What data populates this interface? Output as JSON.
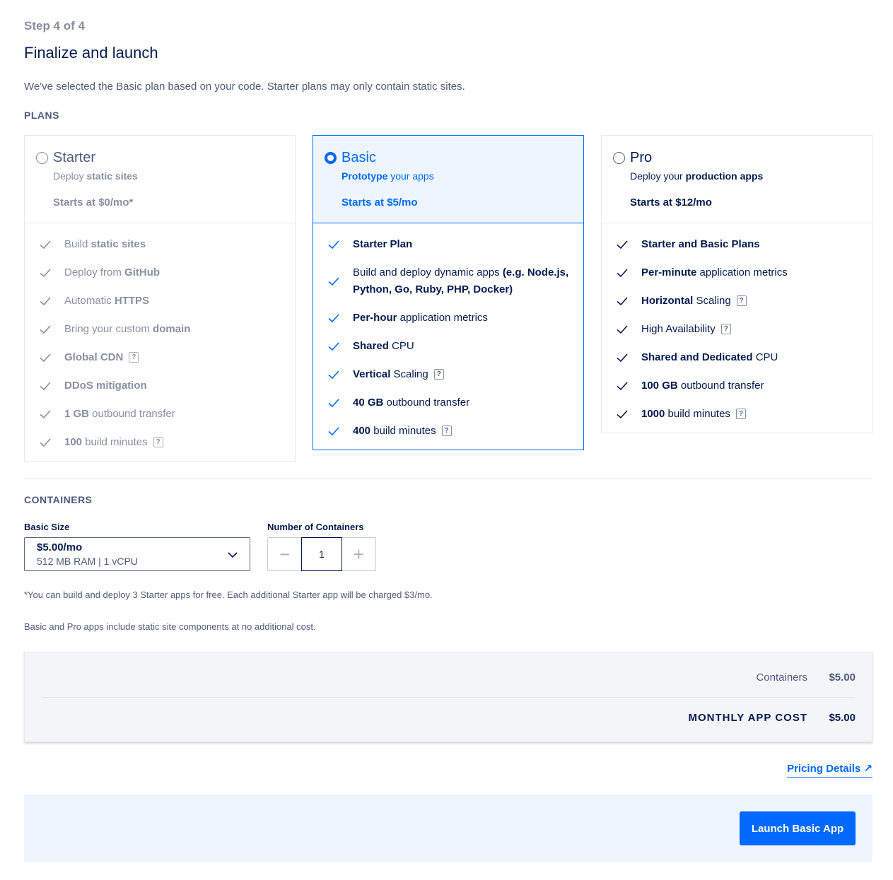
{
  "header": {
    "step": "Step 4 of 4",
    "title": "Finalize and launch",
    "subtitle": "We've selected the Basic plan based on your code. Starter plans may only contain static sites."
  },
  "plans_label": "PLANS",
  "plans": {
    "starter": {
      "name": "Starter",
      "desc_html": "Deploy <b>static sites</b>",
      "price": "Starts at $0/mo*",
      "selected": false,
      "features": [
        {
          "html": "Build <b>static sites</b>",
          "help": false
        },
        {
          "html": "Deploy from <b>GitHub</b>",
          "help": false
        },
        {
          "html": "Automatic <b>HTTPS</b>",
          "help": false
        },
        {
          "html": "Bring your custom <b>domain</b>",
          "help": false
        },
        {
          "html": "<b>Global CDN</b>",
          "help": true
        },
        {
          "html": "<b>DDoS mitigation</b>",
          "help": false
        },
        {
          "html": "<b>1 GB</b> outbound transfer",
          "help": false
        },
        {
          "html": "<b>100</b> build minutes",
          "help": true
        }
      ]
    },
    "basic": {
      "name": "Basic",
      "desc_html": "<b>Prototype</b> your apps",
      "price": "Starts at $5/mo",
      "selected": true,
      "features": [
        {
          "html": "<b>Starter Plan</b>",
          "help": false
        },
        {
          "html": "Build and deploy dynamic apps <b>(e.g. Node.js, Python, Go, Ruby, PHP, Docker)</b>",
          "help": false
        },
        {
          "html": "<b>Per-hour</b> application metrics",
          "help": false
        },
        {
          "html": "<b>Shared</b> CPU",
          "help": false
        },
        {
          "html": "<b>Vertical</b> Scaling",
          "help": true
        },
        {
          "html": "<b>40 GB</b> outbound transfer",
          "help": false
        },
        {
          "html": "<b>400</b> build minutes",
          "help": true
        }
      ]
    },
    "pro": {
      "name": "Pro",
      "desc_html": "Deploy your <b>production apps</b>",
      "price": "Starts at $12/mo",
      "selected": false,
      "features": [
        {
          "html": "<b>Starter and Basic Plans</b>",
          "help": false
        },
        {
          "html": "<b>Per-minute</b> application metrics",
          "help": false
        },
        {
          "html": "<b>Horizontal</b> Scaling",
          "help": true
        },
        {
          "html": "High Availability",
          "help": true
        },
        {
          "html": "<b>Shared and Dedicated</b> CPU",
          "help": false
        },
        {
          "html": "<b>100 GB</b> outbound transfer",
          "help": false
        },
        {
          "html": "<b>1000</b> build minutes",
          "help": true
        }
      ]
    }
  },
  "help_glyph": "?",
  "containers": {
    "label": "CONTAINERS",
    "size_label": "Basic Size",
    "size_price": "$5.00/mo",
    "size_spec": "512 MB RAM | 1 vCPU",
    "count_label": "Number of Containers",
    "count_value": "1",
    "minus": "−",
    "plus": "+"
  },
  "notes": {
    "starter_note": "*You can build and deploy 3 Starter apps for free. Each additional Starter app will be charged $3/mo.",
    "static_note": "Basic and Pro apps include static site components at no additional cost."
  },
  "summary": {
    "containers_label": "Containers",
    "containers_value": "$5.00",
    "total_label": "MONTHLY APP COST",
    "total_value": "$5.00"
  },
  "pricing_link": "Pricing Details ↗",
  "launch_label": "Launch Basic App",
  "colors": {
    "accent": "#0069ff",
    "text": "#031b4e",
    "muted": "#8690a2"
  }
}
